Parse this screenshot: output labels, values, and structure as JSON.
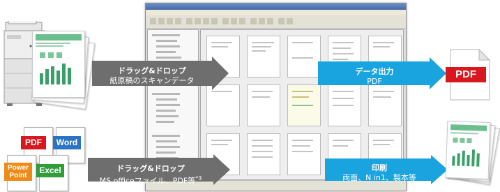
{
  "flow_top": {
    "title": "ドラッグ&ドロップ",
    "subtitle": "紙原稿のスキャンデータ"
  },
  "flow_bottom": {
    "title": "ドラッグ&ドロップ",
    "subtitle": "MS officeファイル、PDF等",
    "footnote": "*3"
  },
  "output_top": {
    "title": "データ出力",
    "subtitle": "PDF"
  },
  "output_bottom": {
    "title": "印刷",
    "subtitle": "両面、N in1、製本等"
  },
  "files": {
    "pdf": "PDF",
    "word": "Word",
    "powerpoint_line1": "Power",
    "powerpoint_line2": "Point",
    "excel": "Excel"
  },
  "output_pdf_label": "PDF",
  "colors": {
    "gray_arrow": "#6e6e6e",
    "blue_arrow": "#1aa4df",
    "pdf_red": "#d8181e",
    "word_blue": "#2b74c4",
    "ppt_orange": "#ef8a17",
    "excel_green": "#2f9e3a"
  }
}
